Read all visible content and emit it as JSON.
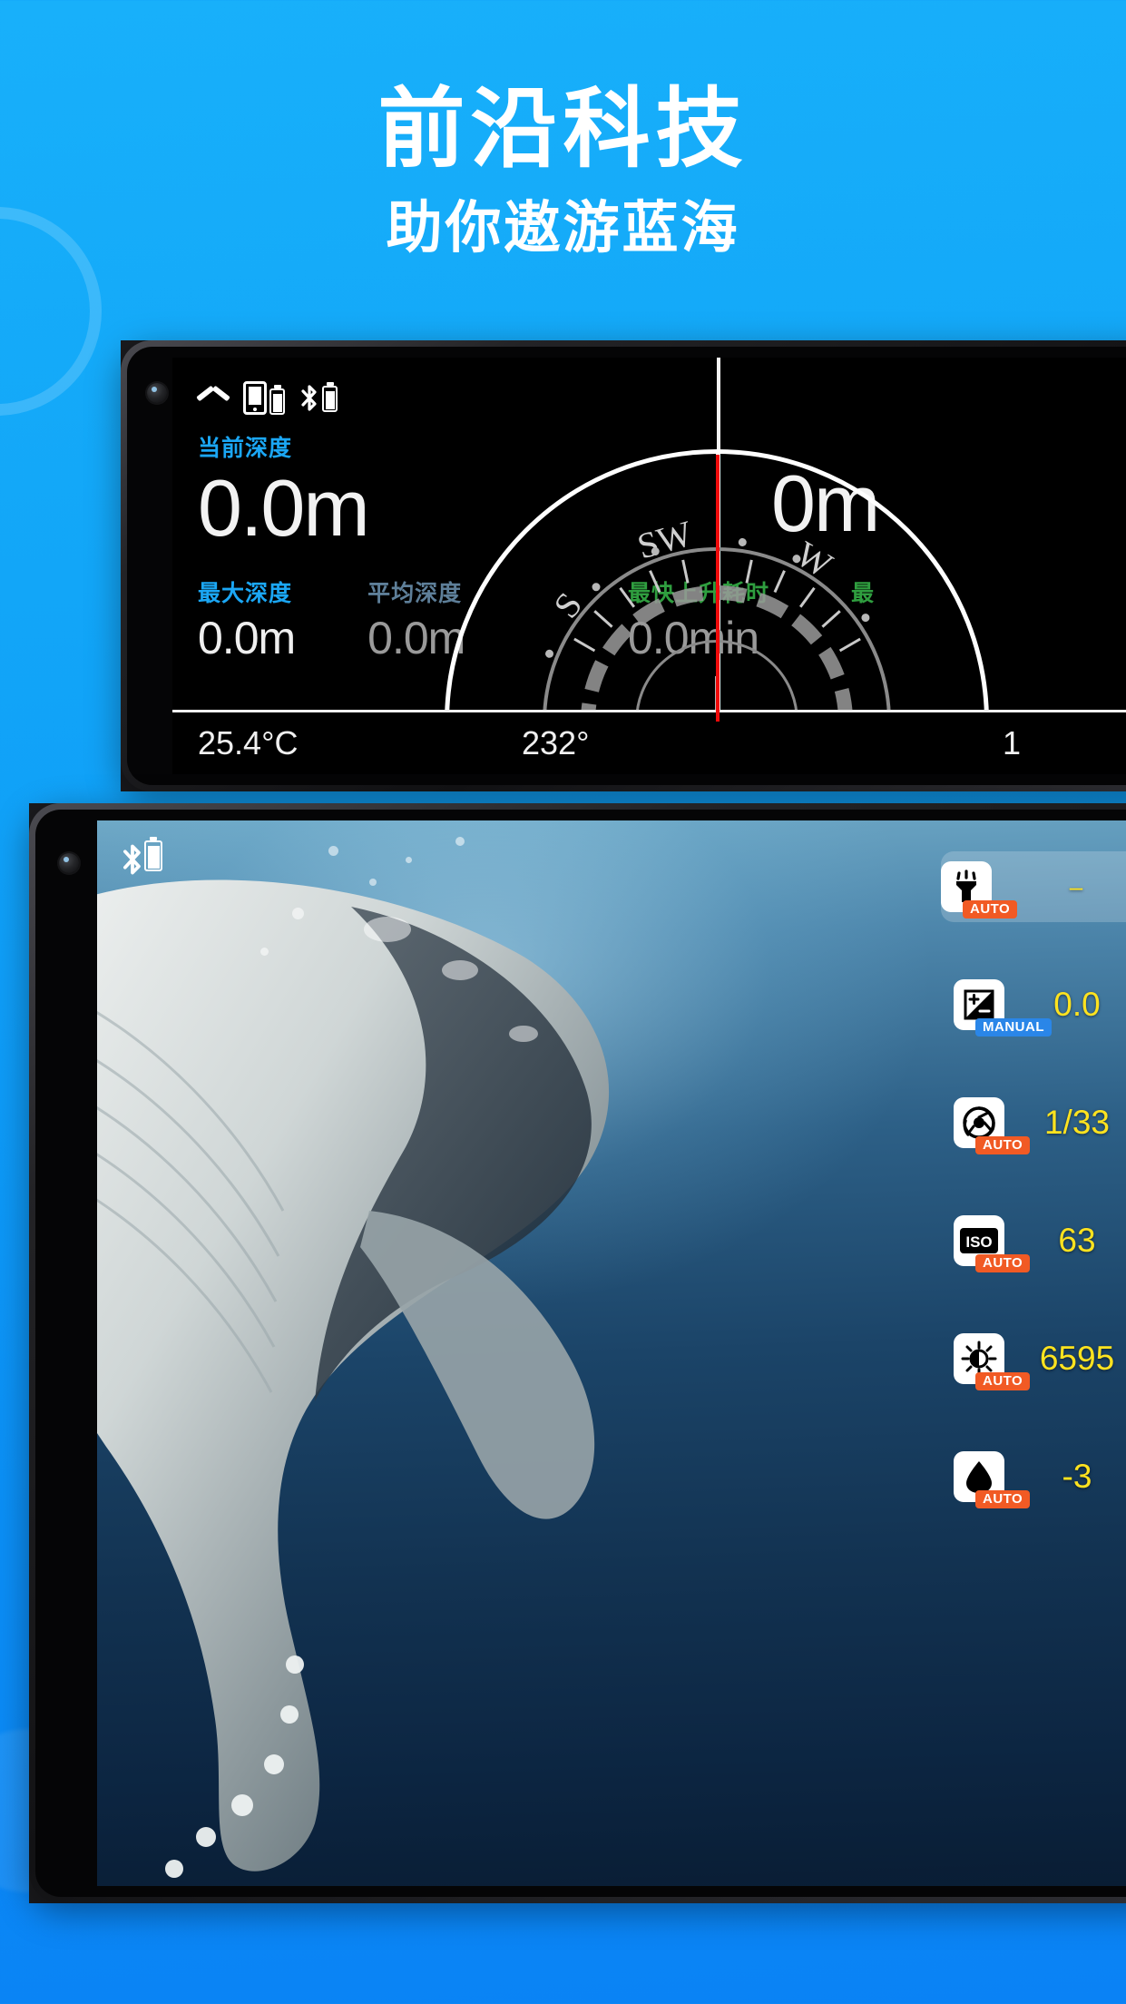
{
  "theme": {
    "bg_start": "#18b0fa",
    "bg_end": "#0a82f5",
    "accent_cyan": "#1ba7f5",
    "accent_green": "#2f9e3f",
    "accent_yellow": "#ffe31f",
    "badge_auto": "#f15a24",
    "badge_manual": "#2a86e8"
  },
  "hero": {
    "headline": "前沿科技",
    "subhead": "助你遨游蓝海"
  },
  "dive_screen": {
    "status_icons": [
      "chevron-up-icon",
      "phone-battery-icon",
      "bluetooth-battery-icon"
    ],
    "primary": {
      "label": "当前深度",
      "value": "0.0m"
    },
    "secondary": [
      {
        "label": "最大深度",
        "value": "0.0m",
        "dim": false
      },
      {
        "label": "平均深度",
        "value": "0.0m",
        "dim": true
      }
    ],
    "right_primary": {
      "label_partial": "",
      "value": "0m"
    },
    "right_secondary": [
      {
        "label": "最快上升耗时",
        "value": "0.0min"
      },
      {
        "label": "最",
        "value": ""
      }
    ],
    "compass": {
      "cardinals": [
        "S",
        "SW",
        "W"
      ],
      "heading_line_color": "#f10a0a"
    },
    "bottom_bar": {
      "temperature": "25.4°C",
      "heading": "232°",
      "extra": "1"
    }
  },
  "camera_screen": {
    "status_icons": [
      "bluetooth-icon",
      "battery-icon"
    ],
    "settings": [
      {
        "icon": "flash-icon",
        "mode": "AUTO",
        "mode_type": "auto",
        "value": "–",
        "highlighted": true
      },
      {
        "icon": "exposure-icon",
        "mode": "MANUAL",
        "mode_type": "manual",
        "value": "0.0",
        "highlighted": false
      },
      {
        "icon": "aperture-icon",
        "mode": "AUTO",
        "mode_type": "auto",
        "value": "1/33",
        "highlighted": false
      },
      {
        "icon": "iso-icon",
        "mode": "AUTO",
        "mode_type": "auto",
        "value": "63",
        "highlighted": false
      },
      {
        "icon": "white-balance-icon",
        "mode": "AUTO",
        "mode_type": "auto",
        "value": "6595",
        "highlighted": false
      },
      {
        "icon": "tint-icon",
        "mode": "AUTO",
        "mode_type": "auto",
        "value": "-3",
        "highlighted": false
      }
    ]
  }
}
